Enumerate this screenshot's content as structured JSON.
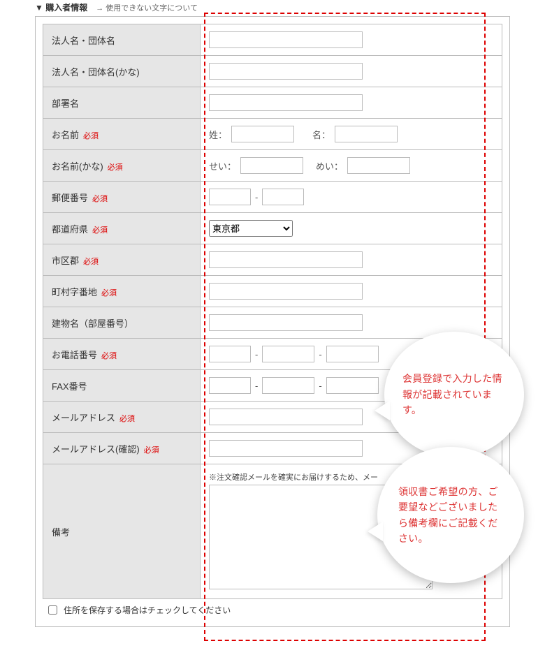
{
  "header": {
    "title": "▼ 購入者情報",
    "char_link": "→ 使用できない文字について"
  },
  "required_label": "必須",
  "rows": {
    "corp_name": {
      "label": "法人名・団体名"
    },
    "corp_name_kana": {
      "label": "法人名・団体名(かな)"
    },
    "dept": {
      "label": "部署名"
    },
    "name": {
      "label": "お名前",
      "req": true,
      "sei": "姓：",
      "mei": "名："
    },
    "name_kana": {
      "label": "お名前(かな)",
      "req": true,
      "sei": "せい：",
      "mei": "めい："
    },
    "postal": {
      "label": "郵便番号",
      "req": true,
      "sep": "-"
    },
    "pref": {
      "label": "都道府県",
      "req": true,
      "selected": "東京都"
    },
    "city": {
      "label": "市区郡",
      "req": true
    },
    "street": {
      "label": "町村字番地",
      "req": true
    },
    "building": {
      "label": "建物名（部屋番号）"
    },
    "tel": {
      "label": "お電話番号",
      "req": true,
      "sep": "-"
    },
    "fax": {
      "label": "FAX番号",
      "sep": "-"
    },
    "email": {
      "label": "メールアドレス",
      "req": true
    },
    "email2": {
      "label": "メールアドレス(確認)",
      "req": true
    },
    "remarks": {
      "label": "備考",
      "note": "※注文確認メールを確実にお届けするため、メー"
    }
  },
  "save_address_label": "住所を保存する場合はチェックしてください",
  "bubbles": {
    "b1": "会員登録で入力した情報が記載されています。",
    "b2": "領収書ご希望の方、ご要望などございましたら備考欄にご記載ください。"
  }
}
